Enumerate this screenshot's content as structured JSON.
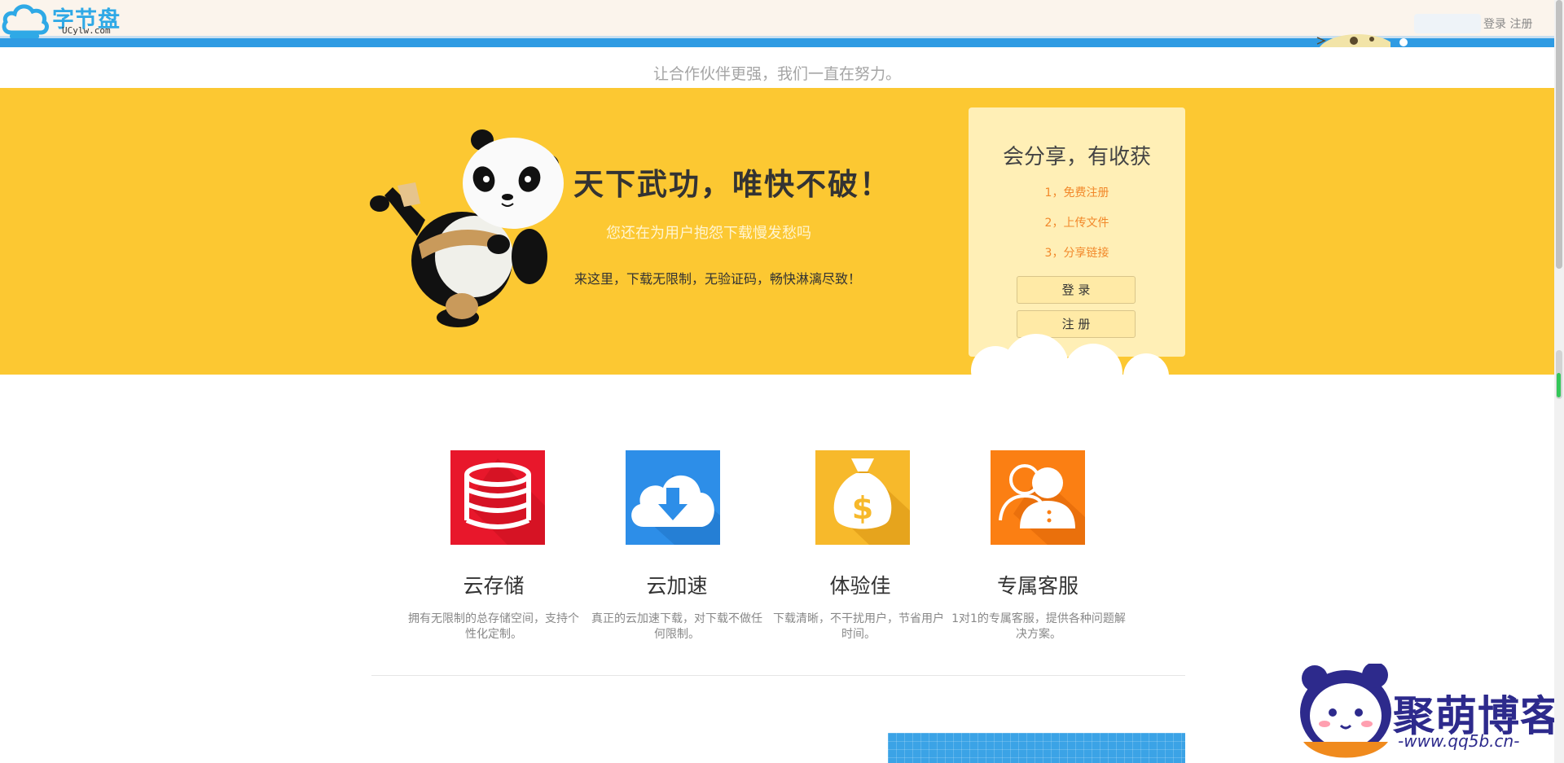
{
  "header": {
    "logo_title": "字节盘",
    "logo_sub": "UCylw.com",
    "login_label": "登录",
    "register_label": "注册"
  },
  "tagline": "让合作伙伴更强，我们一直在努力。",
  "banner": {
    "headline": "天下武功，唯快不破！",
    "subline": "您还在为用户抱怨下载慢发愁吗",
    "desc": "来这里，下载无限制，无验证码，畅快淋漓尽致！",
    "card": {
      "title": "会分享，有收获",
      "steps": [
        "1，免费注册",
        "2，上传文件",
        "3，分享链接"
      ],
      "login_button": "登 录",
      "register_button": "注 册"
    }
  },
  "features": [
    {
      "title": "云存储",
      "desc": "拥有无限制的总存储空间，支持个性化定制。",
      "icon": "database-icon",
      "color": "#e8172b"
    },
    {
      "title": "云加速",
      "desc": "真正的云加速下载，对下载不做任何限制。",
      "icon": "cloud-download-icon",
      "color": "#2d8ee8"
    },
    {
      "title": "体验佳",
      "desc": "下载清晰，不干扰用户，节省用户时间。",
      "icon": "money-bag-icon",
      "color": "#f7b92b"
    },
    {
      "title": "专属客服",
      "desc": "1对1的专属客服，提供各种问题解决方案。",
      "icon": "users-icon",
      "color": "#fb7f13"
    }
  ],
  "watermark": {
    "title": "聚萌博客",
    "url": "-www.qq5b.cn-"
  }
}
